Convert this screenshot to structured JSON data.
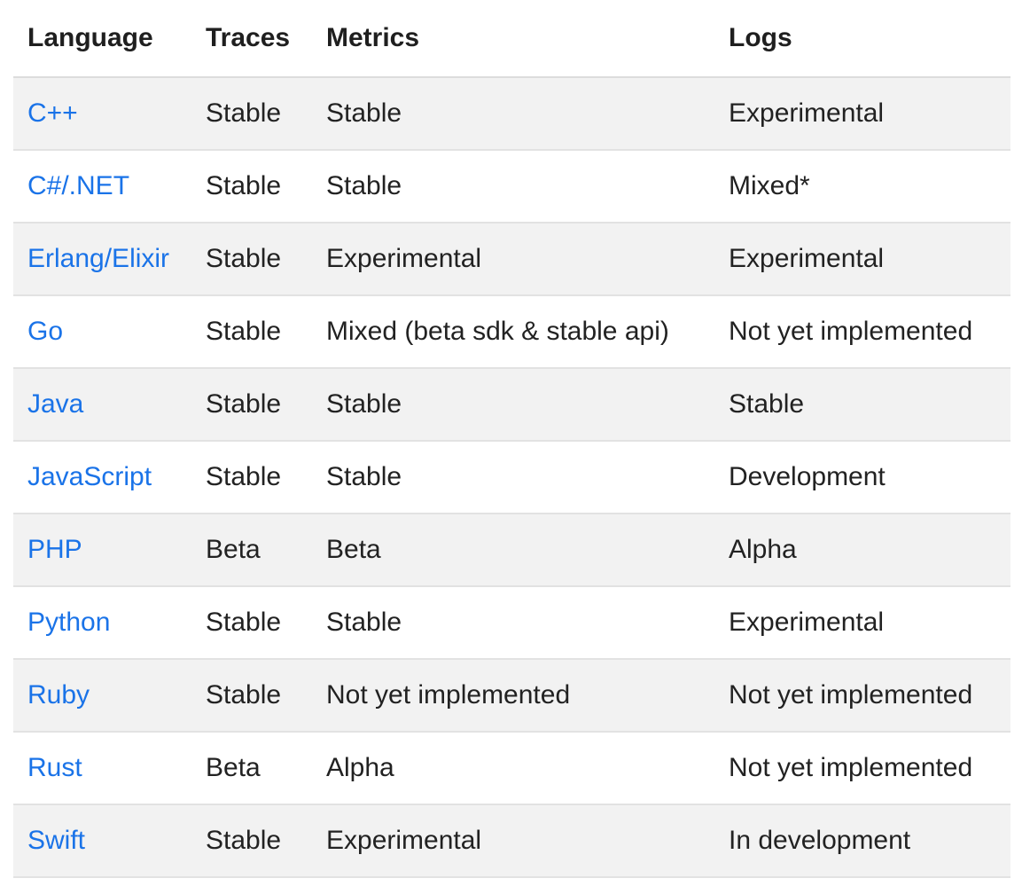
{
  "table": {
    "headers": [
      "Language",
      "Traces",
      "Metrics",
      "Logs"
    ],
    "rows": [
      {
        "language": "C++",
        "traces": "Stable",
        "metrics": "Stable",
        "logs": "Experimental"
      },
      {
        "language": "C#/.NET",
        "traces": "Stable",
        "metrics": "Stable",
        "logs": "Mixed*"
      },
      {
        "language": "Erlang/Elixir",
        "traces": "Stable",
        "metrics": "Experimental",
        "logs": "Experimental"
      },
      {
        "language": "Go",
        "traces": "Stable",
        "metrics": "Mixed (beta sdk & stable api)",
        "logs": "Not yet implemented"
      },
      {
        "language": "Java",
        "traces": "Stable",
        "metrics": "Stable",
        "logs": "Stable"
      },
      {
        "language": "JavaScript",
        "traces": "Stable",
        "metrics": "Stable",
        "logs": "Development"
      },
      {
        "language": "PHP",
        "traces": "Beta",
        "metrics": "Beta",
        "logs": "Alpha"
      },
      {
        "language": "Python",
        "traces": "Stable",
        "metrics": "Stable",
        "logs": "Experimental"
      },
      {
        "language": "Ruby",
        "traces": "Stable",
        "metrics": "Not yet implemented",
        "logs": "Not yet implemented"
      },
      {
        "language": "Rust",
        "traces": "Beta",
        "metrics": "Alpha",
        "logs": "Not yet implemented"
      },
      {
        "language": "Swift",
        "traces": "Stable",
        "metrics": "Experimental",
        "logs": "In development"
      }
    ]
  },
  "colors": {
    "link": "#1a73e8",
    "text": "#222222",
    "stripe": "#f2f2f2",
    "border": "#e2e2e2"
  }
}
